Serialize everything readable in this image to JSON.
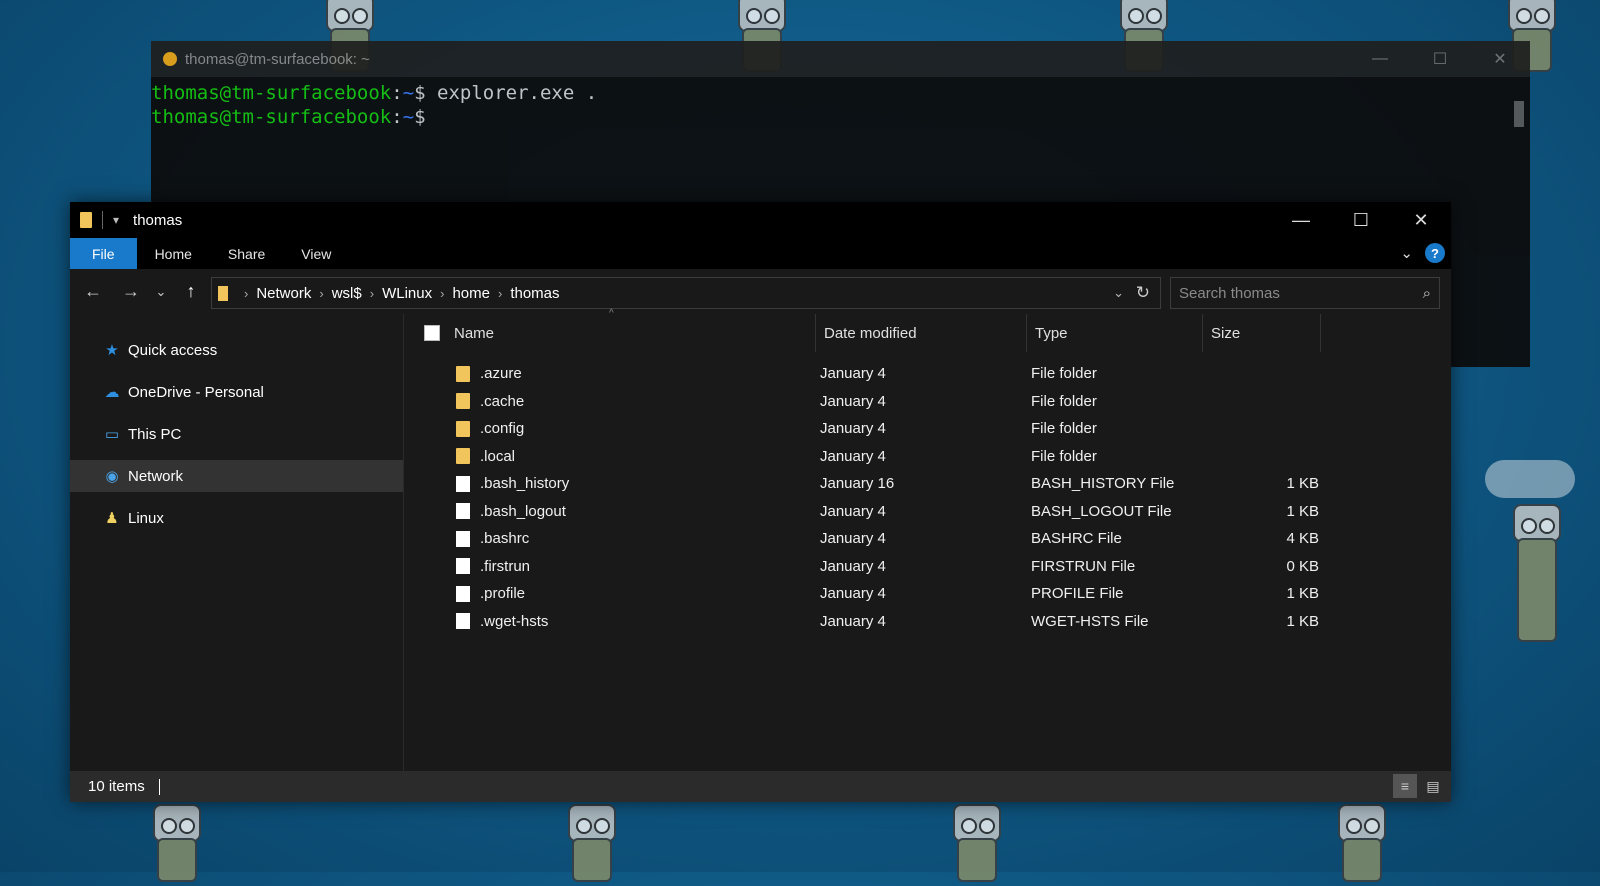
{
  "terminal": {
    "title": "thomas@tm-surfacebook: ~",
    "lines": [
      {
        "user": "thomas@tm-surfacebook",
        "sep": ":",
        "path": "~",
        "dollar": "$",
        "cmd": " explorer.exe ."
      },
      {
        "user": "thomas@tm-surfacebook",
        "sep": ":",
        "path": "~",
        "dollar": "$",
        "cmd": ""
      }
    ],
    "controls": {
      "minimize": "—",
      "maximize": "☐",
      "close": "✕"
    }
  },
  "explorer": {
    "title": "thomas",
    "controls": {
      "minimize": "—",
      "maximize": "☐",
      "close": "✕"
    },
    "ribbon": {
      "tabs": [
        "File",
        "Home",
        "Share",
        "View"
      ],
      "expand": "⌄",
      "help": "?"
    },
    "nav": {
      "back": "←",
      "forward": "→",
      "recent": "⌄",
      "up": "↑"
    },
    "breadcrumb": [
      "Network",
      "wsl$",
      "WLinux",
      "home",
      "thomas"
    ],
    "search": {
      "placeholder": "Search thomas"
    },
    "sidebar": [
      {
        "label": "Quick access",
        "icon": "star-icon",
        "glyph": "★",
        "color": "#2f8fe0"
      },
      {
        "label": "OneDrive - Personal",
        "icon": "cloud-icon",
        "glyph": "☁",
        "color": "#2f8fe0"
      },
      {
        "label": "This PC",
        "icon": "computer-icon",
        "glyph": "▭",
        "color": "#4aa3e8"
      },
      {
        "label": "Network",
        "icon": "network-icon",
        "glyph": "◉",
        "color": "#4aa3e8",
        "selected": true
      },
      {
        "label": "Linux",
        "icon": "penguin-icon",
        "glyph": "♟",
        "color": "#f0d060"
      }
    ],
    "columns": [
      "Name",
      "Date modified",
      "Type",
      "Size"
    ],
    "files": [
      {
        "name": ".azure",
        "date": "January 4",
        "type": "File folder",
        "size": "",
        "kind": "folder"
      },
      {
        "name": ".cache",
        "date": "January 4",
        "type": "File folder",
        "size": "",
        "kind": "folder"
      },
      {
        "name": ".config",
        "date": "January 4",
        "type": "File folder",
        "size": "",
        "kind": "folder"
      },
      {
        "name": ".local",
        "date": "January 4",
        "type": "File folder",
        "size": "",
        "kind": "folder"
      },
      {
        "name": ".bash_history",
        "date": "January 16",
        "type": "BASH_HISTORY File",
        "size": "1 KB",
        "kind": "file"
      },
      {
        "name": ".bash_logout",
        "date": "January 4",
        "type": "BASH_LOGOUT File",
        "size": "1 KB",
        "kind": "file"
      },
      {
        "name": ".bashrc",
        "date": "January 4",
        "type": "BASHRC File",
        "size": "4 KB",
        "kind": "file"
      },
      {
        "name": ".firstrun",
        "date": "January 4",
        "type": "FIRSTRUN File",
        "size": "0 KB",
        "kind": "file"
      },
      {
        "name": ".profile",
        "date": "January 4",
        "type": "PROFILE File",
        "size": "1 KB",
        "kind": "file"
      },
      {
        "name": ".wget-hsts",
        "date": "January 4",
        "type": "WGET-HSTS File",
        "size": "1 KB",
        "kind": "file"
      }
    ],
    "status": {
      "count": "10 items"
    }
  }
}
